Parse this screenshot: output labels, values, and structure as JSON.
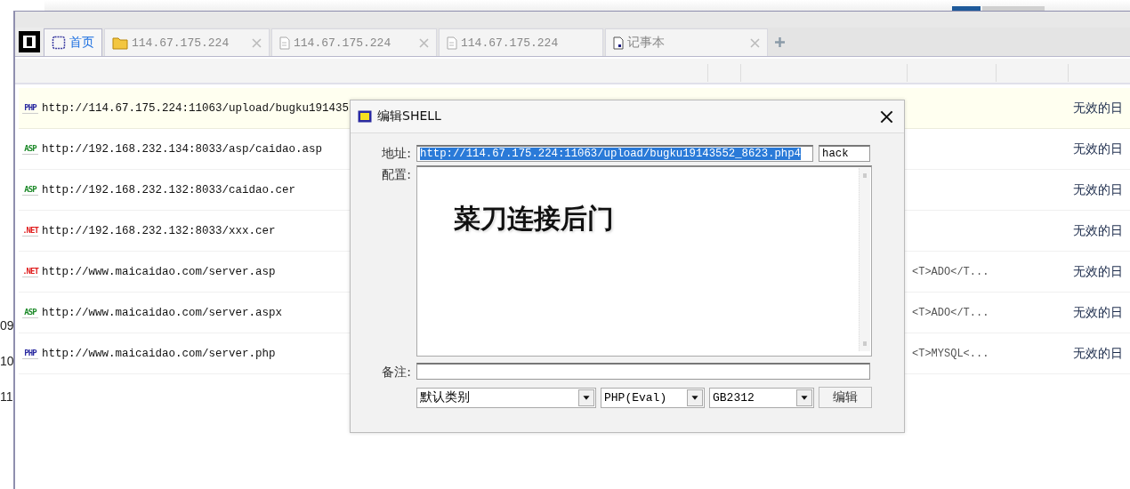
{
  "background_window": {
    "texts": [
      "09",
      "10",
      "11"
    ]
  },
  "tabs": [
    {
      "label": "首页",
      "kind": "home",
      "selected": true,
      "closable": false
    },
    {
      "label": "114.67.175.224",
      "kind": "folder",
      "selected": false,
      "closable": true
    },
    {
      "label": "114.67.175.224",
      "kind": "file",
      "selected": false,
      "closable": true
    },
    {
      "label": "114.67.175.224",
      "kind": "file",
      "selected": false,
      "closable": false
    },
    {
      "label": "记事本",
      "kind": "notepad",
      "selected": false,
      "closable": true
    }
  ],
  "list": {
    "rows": [
      {
        "color": "#2a2aa0",
        "badge": "PHP",
        "url": "http://114.67.175.224:11063/upload/bugku191435",
        "column_4": "",
        "column_5": "无效的日",
        "selected": true
      },
      {
        "color": "#1e8a2a",
        "badge": "ASP",
        "url": "http://192.168.232.134:8033/asp/caidao.asp",
        "column_4": "",
        "column_5": "无效的日",
        "selected": false
      },
      {
        "color": "#1e8a2a",
        "badge": "ASP",
        "url": "http://192.168.232.132:8033/caidao.cer",
        "column_4": "",
        "column_5": "无效的日",
        "selected": false
      },
      {
        "color": "#e02020",
        "badge": ".NET",
        "url": "http://192.168.232.132:8033/xxx.cer",
        "column_4": "",
        "column_5": "无效的日",
        "selected": false
      },
      {
        "color": "#e02020",
        "badge": ".NET",
        "url": "http://www.maicaidao.com/server.asp",
        "column_4": "<T>ADO</T...",
        "column_5": "无效的日",
        "selected": false
      },
      {
        "color": "#1e8a2a",
        "badge": "ASP",
        "url": "http://www.maicaidao.com/server.aspx",
        "column_4": "<T>ADO</T...",
        "column_5": "无效的日",
        "selected": false
      },
      {
        "color": "#2a2aa0",
        "badge": "PHP",
        "url": "http://www.maicaidao.com/server.php",
        "column_4": "<T>MYSQL<...",
        "column_5": "无效的日",
        "selected": false
      }
    ]
  },
  "dialog": {
    "title": "编辑SHELL",
    "address_label": "地址:",
    "address": "http://114.67.175.224:11063/upload/bugku19143552_8623.php4",
    "address_selected": true,
    "password": "hack",
    "config_label": "配置:",
    "note_label": "备注:",
    "category": "默认类别",
    "script_type": "PHP(Eval)",
    "encoding": "GB2312",
    "submit": "编辑"
  },
  "annotation": "菜刀连接后门"
}
